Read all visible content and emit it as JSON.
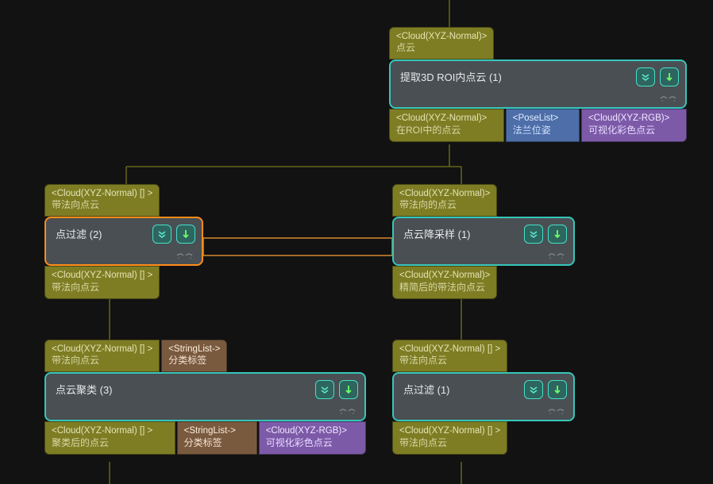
{
  "nodes": {
    "roi": {
      "in1": {
        "type": "<Cloud(XYZ-Normal)>",
        "label": "点云"
      },
      "title": "提取3D ROI内点云 (1)",
      "out1": {
        "type": "<Cloud(XYZ-Normal)>",
        "label": "在ROI中的点云"
      },
      "out2": {
        "type": "<PoseList>",
        "label": "法兰位姿"
      },
      "out3": {
        "type": "<Cloud(XYZ-RGB)>",
        "label": "可视化彩色点云"
      }
    },
    "filter2": {
      "in1": {
        "type": "<Cloud(XYZ-Normal) [] >",
        "label": "带法向点云"
      },
      "title": "点过滤 (2)",
      "out1": {
        "type": "<Cloud(XYZ-Normal) [] >",
        "label": "带法向点云"
      }
    },
    "down": {
      "in1": {
        "type": "<Cloud(XYZ-Normal)>",
        "label": "带法向的点云"
      },
      "title": "点云降采样 (1)",
      "out1": {
        "type": "<Cloud(XYZ-Normal)>",
        "label": "精简后的带法向点云"
      }
    },
    "cluster": {
      "in1": {
        "type": "<Cloud(XYZ-Normal) [] >",
        "label": "带法向点云"
      },
      "in2": {
        "type": "<StringList->",
        "label": "分类标签"
      },
      "title": "点云聚类 (3)",
      "out1": {
        "type": "<Cloud(XYZ-Normal) [] >",
        "label": "聚类后的点云"
      },
      "out2": {
        "type": "<StringList->",
        "label": "分类标签"
      },
      "out3": {
        "type": "<Cloud(XYZ-RGB)>",
        "label": "可视化彩色点云"
      }
    },
    "filter1": {
      "in1": {
        "type": "<Cloud(XYZ-Normal) [] >",
        "label": "带法向点云"
      },
      "title": "点过滤 (1)",
      "out1": {
        "type": "<Cloud(XYZ-Normal) [] >",
        "label": "带法向点云"
      }
    }
  },
  "colors": {
    "canvas": "#121212",
    "olive": "#7e7d24",
    "blue": "#4d6ea8",
    "purple": "#7d5aa8",
    "brown": "#7a5a3f",
    "bodyFill": "#4a4f53",
    "bodyBorder": "#35c6ba",
    "selected": "#ff8c1a",
    "wire": "#65651d"
  }
}
